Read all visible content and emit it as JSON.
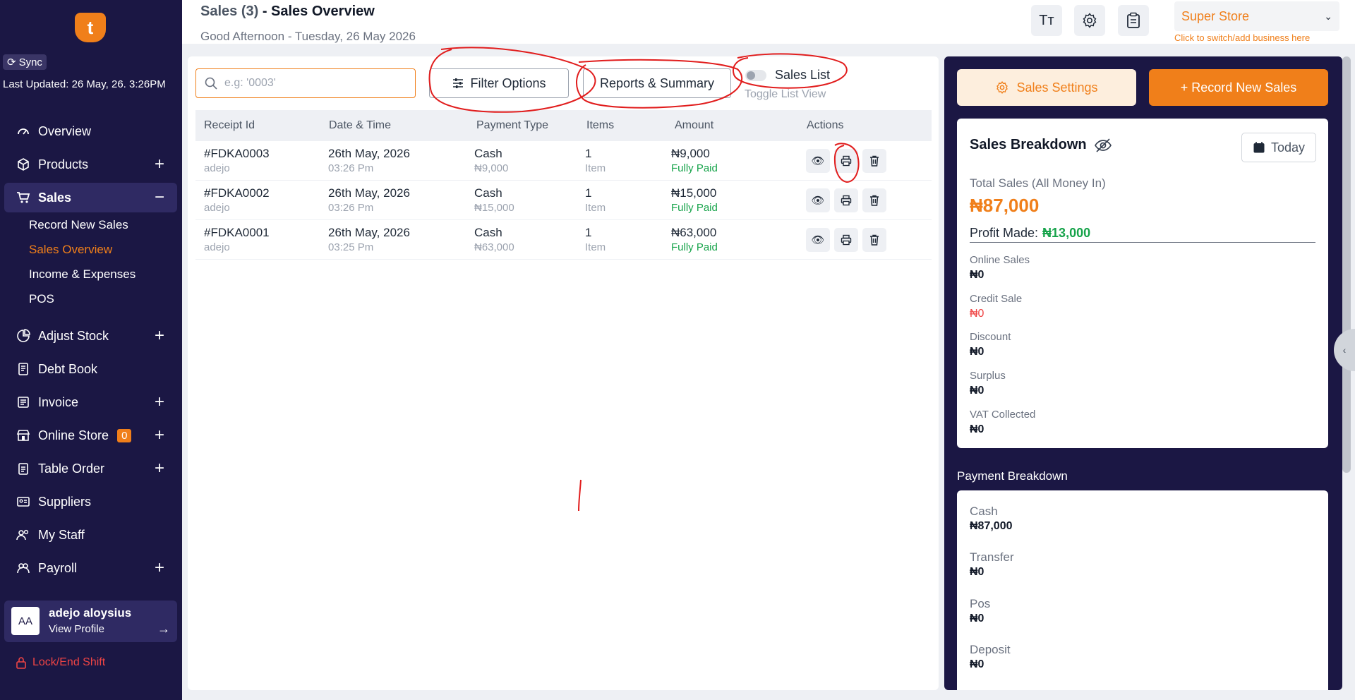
{
  "sidebar": {
    "sync_label": "Sync",
    "last_updated": "Last Updated: 26 May, 26. 3:26PM",
    "items": [
      {
        "label": "Overview",
        "icon": "gauge-icon",
        "expandable": false
      },
      {
        "label": "Products",
        "icon": "box-icon",
        "expandable": true
      },
      {
        "label": "Sales",
        "icon": "cart-icon",
        "expandable": true,
        "expanded": true
      },
      {
        "label": "Adjust Stock",
        "icon": "pie-icon",
        "expandable": true
      },
      {
        "label": "Debt Book",
        "icon": "book-icon",
        "expandable": false
      },
      {
        "label": "Invoice",
        "icon": "invoice-icon",
        "expandable": true
      },
      {
        "label": "Online Store",
        "icon": "store-icon",
        "expandable": true,
        "badge": "0"
      },
      {
        "label": "Table Order",
        "icon": "clipboard-icon",
        "expandable": true
      },
      {
        "label": "Suppliers",
        "icon": "id-card-icon",
        "expandable": false
      },
      {
        "label": "My Staff",
        "icon": "users-icon",
        "expandable": false
      },
      {
        "label": "Payroll",
        "icon": "payroll-icon",
        "expandable": true
      }
    ],
    "sales_sub": [
      "Record New Sales",
      "Sales Overview",
      "Income & Expenses",
      "POS"
    ],
    "profile": {
      "initials": "AA",
      "name": "adejo aloysius",
      "link": "View Profile"
    },
    "lock_label": "Lock/End Shift"
  },
  "header": {
    "count_prefix": "Sales (3)",
    "title_suffix": " - Sales Overview",
    "greeting": "Good Afternoon - Tuesday, 26 May 2026",
    "store_name": "Super Store",
    "store_hint": "Click to switch/add business here",
    "font_btn": "Tт"
  },
  "toolbar": {
    "search_placeholder": "e.g: '0003'",
    "filter_label": "Filter Options",
    "reports_label": "Reports & Summary",
    "toggle_label": "Sales List",
    "toggle_hint": "Toggle List View"
  },
  "table": {
    "columns": [
      "Receipt Id",
      "Date & Time",
      "Payment Type",
      "Items",
      "Amount",
      "Actions"
    ],
    "rows": [
      {
        "id": "#FDKA0003",
        "user": "adejo",
        "date": "26th May, 2026",
        "time": "03:26 Pm",
        "pay": "Cash",
        "pay_amt": "₦9,000",
        "items": "1",
        "items_unit": "Item",
        "amount": "₦9,000",
        "status": "Fully Paid"
      },
      {
        "id": "#FDKA0002",
        "user": "adejo",
        "date": "26th May, 2026",
        "time": "03:26 Pm",
        "pay": "Cash",
        "pay_amt": "₦15,000",
        "items": "1",
        "items_unit": "Item",
        "amount": "₦15,000",
        "status": "Fully Paid"
      },
      {
        "id": "#FDKA0001",
        "user": "adejo",
        "date": "26th May, 2026",
        "time": "03:25 Pm",
        "pay": "Cash",
        "pay_amt": "₦63,000",
        "items": "1",
        "items_unit": "Item",
        "amount": "₦63,000",
        "status": "Fully Paid"
      }
    ]
  },
  "right": {
    "settings_label": "Sales Settings",
    "record_label": "+ Record New Sales",
    "breakdown_title": "Sales Breakdown",
    "today_label": "Today",
    "total_label": "Total Sales (All Money In)",
    "total_value": "₦87,000",
    "profit_label": "Profit Made:",
    "profit_value": "₦13,000",
    "stats": [
      {
        "label": "Online Sales",
        "value": "₦0"
      },
      {
        "label": "Credit Sale",
        "value": "₦0"
      },
      {
        "label": "Discount",
        "value": "₦0"
      },
      {
        "label": "Surplus",
        "value": "₦0"
      },
      {
        "label": "VAT Collected",
        "value": "₦0"
      }
    ],
    "payment_title": "Payment Breakdown",
    "payments": [
      {
        "label": "Cash",
        "value": "₦87,000"
      },
      {
        "label": "Transfer",
        "value": "₦0"
      },
      {
        "label": "Pos",
        "value": "₦0"
      },
      {
        "label": "Deposit",
        "value": "₦0"
      }
    ]
  },
  "colors": {
    "brand": "#f07f1a",
    "sidebar": "#1b1744",
    "success": "#16a34a",
    "danger": "#ef4444",
    "annotation": "#e11d1d"
  }
}
